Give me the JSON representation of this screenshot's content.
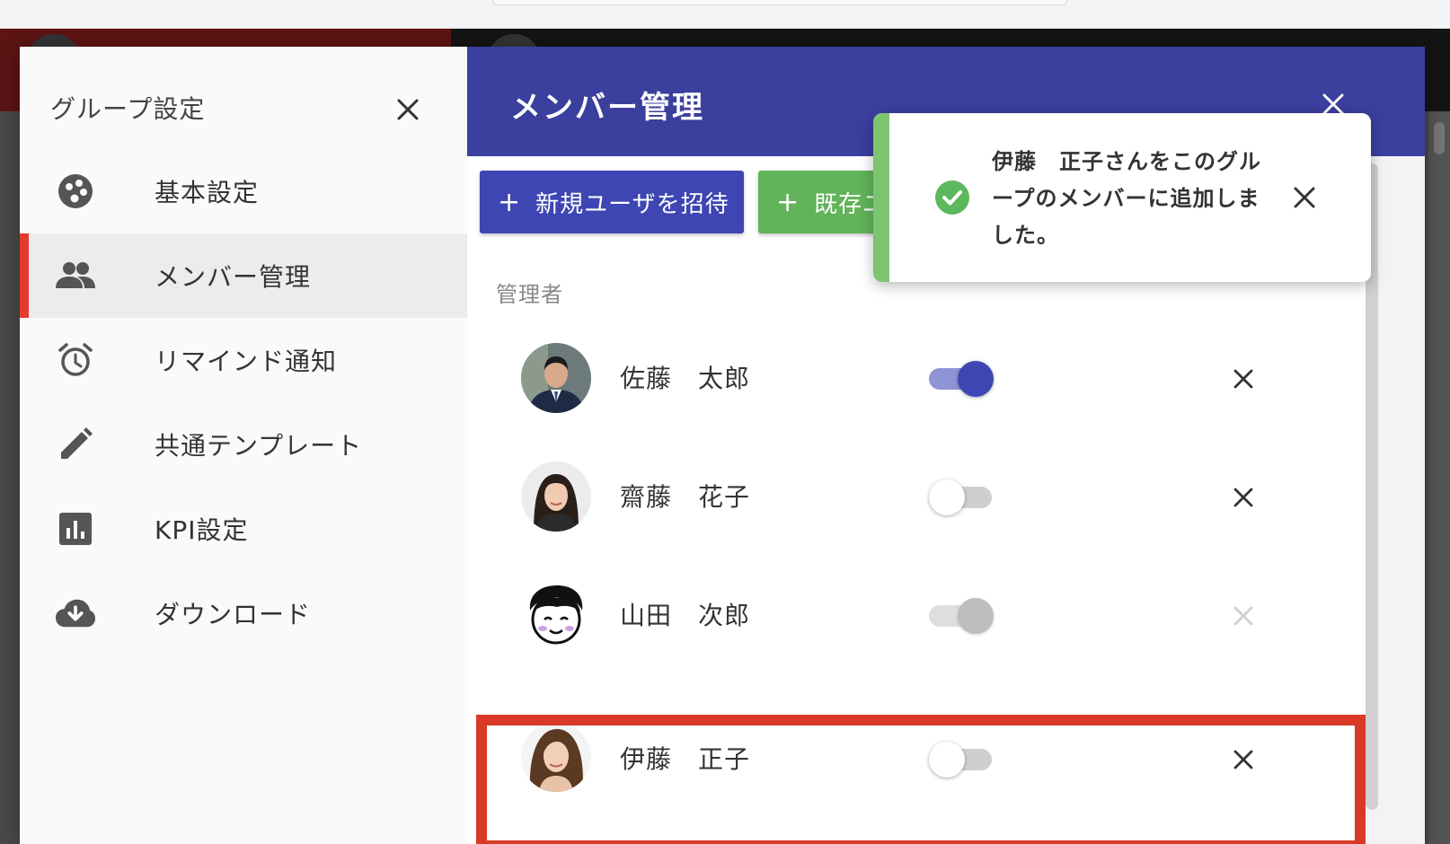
{
  "sidebar": {
    "title": "グループ設定",
    "items": [
      {
        "label": "基本設定",
        "icon": "palette-icon"
      },
      {
        "label": "メンバー管理",
        "icon": "people-icon",
        "active": true
      },
      {
        "label": "リマインド通知",
        "icon": "alarm-icon"
      },
      {
        "label": "共通テンプレート",
        "icon": "pencil-icon"
      },
      {
        "label": "KPI設定",
        "icon": "bar-chart-icon"
      },
      {
        "label": "ダウンロード",
        "icon": "cloud-download-icon"
      }
    ]
  },
  "main": {
    "title": "メンバー管理",
    "buttons": {
      "invite_label": "新規ユーザを招待",
      "existing_label": "既存ユ"
    },
    "section_label": "管理者",
    "members": [
      {
        "name": "佐藤　太郎",
        "admin": "on"
      },
      {
        "name": "齋藤　花子",
        "admin": "off"
      },
      {
        "name": "山田　次郎",
        "admin": "disabled"
      },
      {
        "name": "伊藤　正子",
        "admin": "off"
      }
    ]
  },
  "toast": {
    "message": "伊藤　正子さんをこのグループのメンバーに追加しました。"
  },
  "colors": {
    "header_blue": "#3b3f9e",
    "invite_button": "#3d46b3",
    "existing_button": "#62b35a",
    "active_indicator": "#e53a2e",
    "highlight_red": "#d93a28",
    "toast_green": "#7cc46f"
  }
}
